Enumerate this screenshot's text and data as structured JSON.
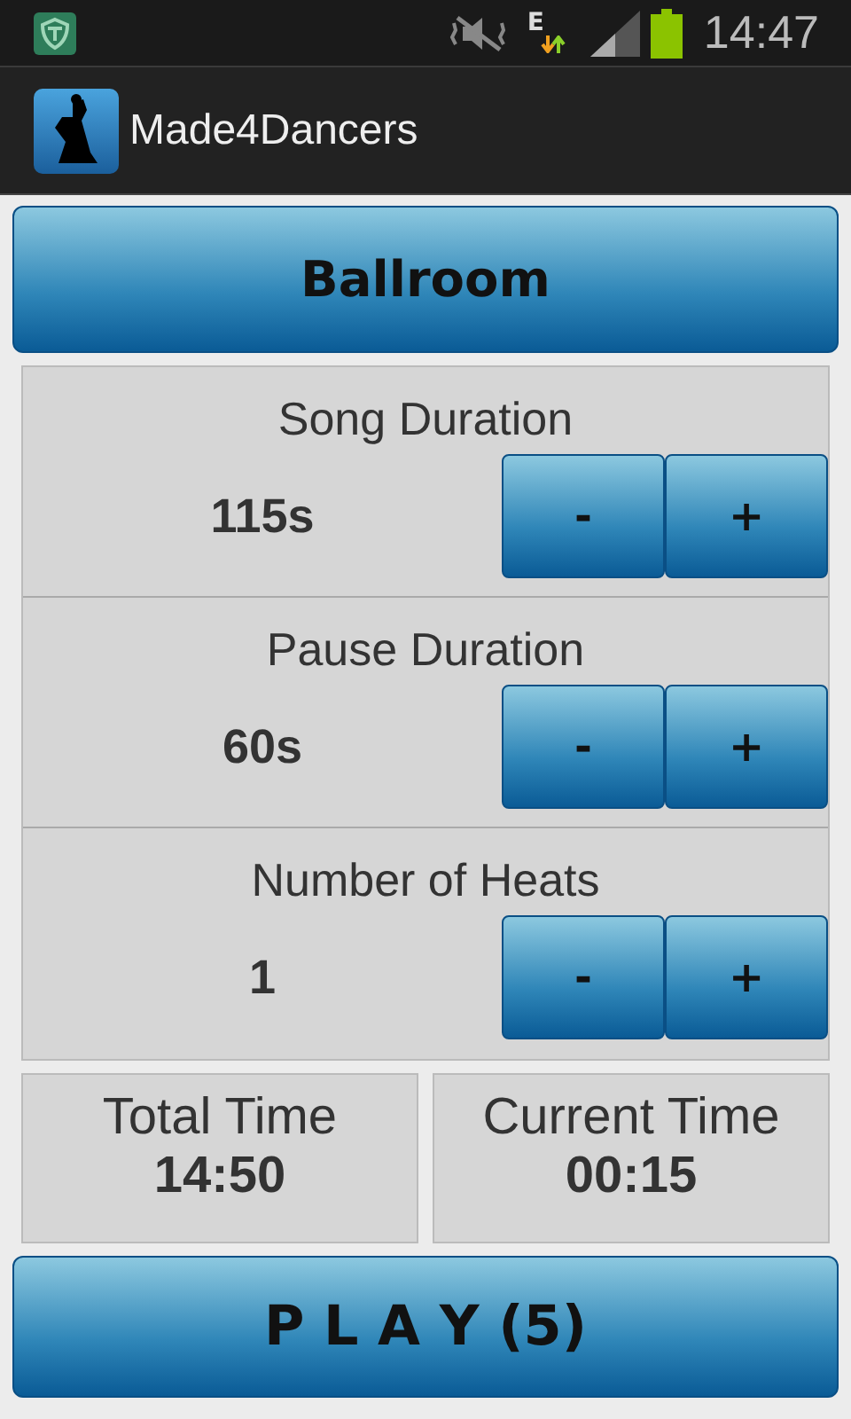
{
  "status_bar": {
    "network_type": "E",
    "time": "14:47"
  },
  "action_bar": {
    "title": "Made4Dancers"
  },
  "category_button": {
    "label": "Ballroom"
  },
  "settings": [
    {
      "title": "Song Duration",
      "value": "115s",
      "minus": "-",
      "plus": "+"
    },
    {
      "title": "Pause Duration",
      "value": "60s",
      "minus": "-",
      "plus": "+"
    },
    {
      "title": "Number of Heats",
      "value": "1",
      "minus": "-",
      "plus": "+"
    }
  ],
  "times": [
    {
      "label": "Total Time",
      "value": "14:50"
    },
    {
      "label": "Current Time",
      "value": "00:15"
    }
  ],
  "play_button": {
    "label": "P L A Y (5)"
  }
}
